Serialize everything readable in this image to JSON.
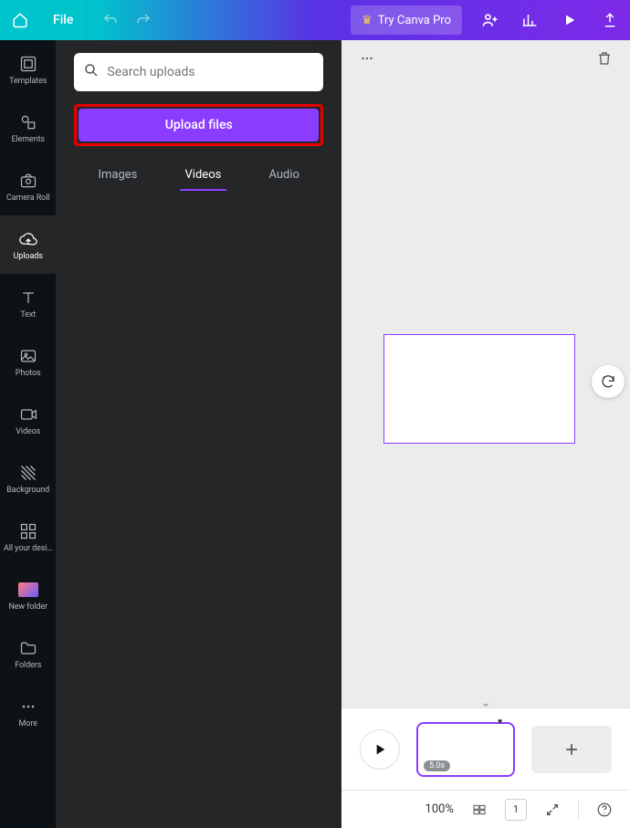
{
  "top": {
    "file": "File",
    "tryPro": "Try Canva Pro"
  },
  "rail": {
    "templates": "Templates",
    "elements": "Elements",
    "camera": "Camera Roll",
    "uploads": "Uploads",
    "text": "Text",
    "photos": "Photos",
    "videos": "Videos",
    "background": "Background",
    "allDesigns": "All your desi…",
    "newFolder": "New folder",
    "folders": "Folders",
    "more": "More"
  },
  "panel": {
    "searchPlaceholder": "Search uploads",
    "uploadBtn": "Upload files",
    "tabs": {
      "images": "Images",
      "videos": "Videos",
      "audio": "Audio"
    }
  },
  "timeline": {
    "clipDuration": "5.0s"
  },
  "bottom": {
    "zoom": "100%",
    "pageNum": "1"
  }
}
